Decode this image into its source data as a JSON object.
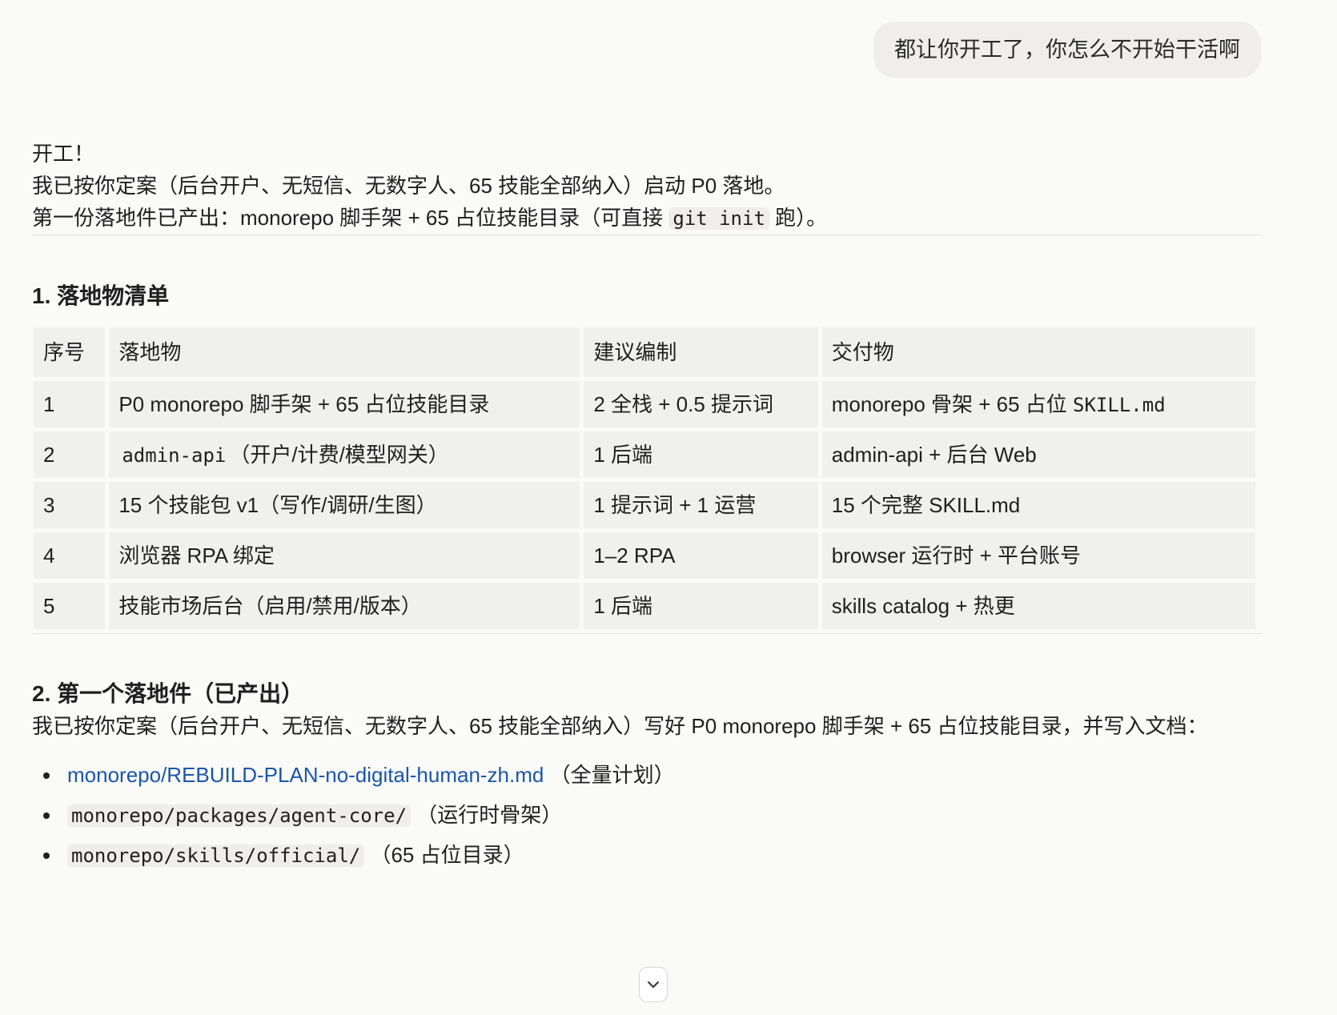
{
  "user_message": "都让你开工了，你怎么不开始干活啊",
  "reply": {
    "intro": {
      "line1": "开工！",
      "line2": "我已按你定案（后台开户、无短信、无数字人、65 技能全部纳入）启动 P0 落地。",
      "line3_prefix": "第一份落地件已产出：monorepo 脚手架 + 65 占位技能目录（可直接 ",
      "line3_code": "git init",
      "line3_suffix": " 跑）。"
    },
    "section1": {
      "heading": "1. 落地物清单",
      "columns": [
        "序号",
        "落地物",
        "建议编制",
        "交付物"
      ],
      "rows": [
        {
          "no": "1",
          "item": "P0 monorepo 脚手架 + 65 占位技能目录",
          "item_code": "",
          "item_suffix": "",
          "staff": "2 全栈 + 0.5 提示词",
          "deliverable": "monorepo 骨架 + 65 占位 ",
          "deliverable_code": "SKILL.md"
        },
        {
          "no": "2",
          "item": "",
          "item_code": "admin-api",
          "item_suffix": "（开户/计费/模型网关）",
          "staff": "1 后端",
          "deliverable": "admin-api + 后台 Web",
          "deliverable_code": ""
        },
        {
          "no": "3",
          "item": "15 个技能包 v1（写作/调研/生图）",
          "item_code": "",
          "item_suffix": "",
          "staff": "1 提示词 + 1 运营",
          "deliverable": "15 个完整 SKILL.md",
          "deliverable_code": ""
        },
        {
          "no": "4",
          "item": "浏览器 RPA 绑定",
          "item_code": "",
          "item_suffix": "",
          "staff": "1–2 RPA",
          "deliverable": "browser 运行时 + 平台账号",
          "deliverable_code": ""
        },
        {
          "no": "5",
          "item": "技能市场后台（启用/禁用/版本）",
          "item_code": "",
          "item_suffix": "",
          "staff": "1 后端",
          "deliverable": "skills catalog + 热更",
          "deliverable_code": ""
        }
      ]
    },
    "section2": {
      "heading": "2. 第一个落地件（已产出）",
      "description": "我已按你定案（后台开户、无短信、无数字人、65 技能全部纳入）写好 P0 monorepo 脚手架 + 65 占位技能目录，并写入文档：",
      "files": [
        {
          "path": "monorepo/REBUILD-PLAN-no-digital-human-zh.md",
          "note": "（全量计划）"
        },
        {
          "path": "monorepo/packages/agent-core/",
          "note": "（运行时骨架）"
        },
        {
          "path": "monorepo/skills/official/",
          "note": "（65 占位目录）"
        }
      ]
    }
  },
  "icons": {
    "scroll_down": "chevron-down-icon"
  },
  "colors": {
    "background": "#fafaf9",
    "bubble": "#efeeec",
    "cell": "#f0f0ef",
    "link": "#1a56a8"
  }
}
